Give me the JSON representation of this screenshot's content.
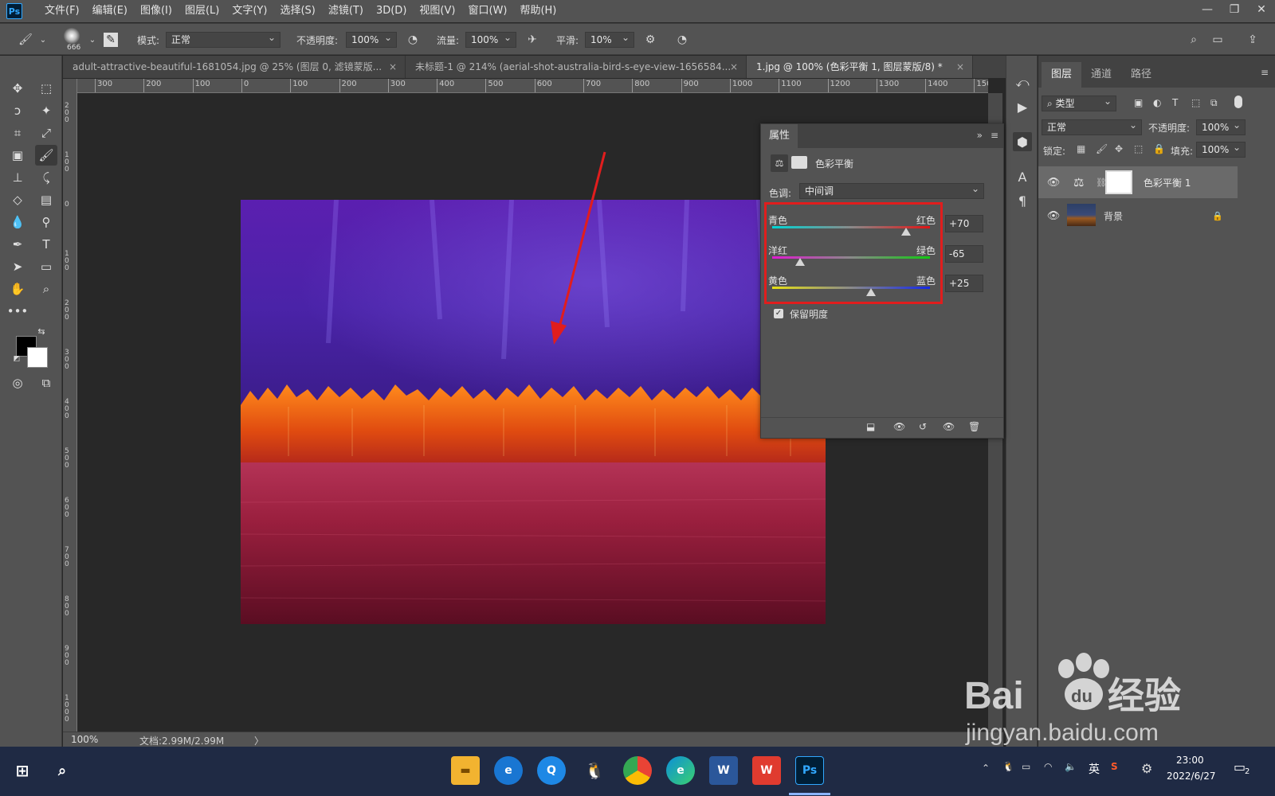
{
  "app": {
    "logo": "Ps"
  },
  "menu": [
    "文件(F)",
    "编辑(E)",
    "图像(I)",
    "图层(L)",
    "文字(Y)",
    "选择(S)",
    "滤镜(T)",
    "3D(D)",
    "视图(V)",
    "窗口(W)",
    "帮助(H)"
  ],
  "options": {
    "brush_size": "666",
    "mode_label": "模式:",
    "mode_value": "正常",
    "opacity_label": "不透明度:",
    "opacity_value": "100%",
    "flow_label": "流量:",
    "flow_value": "100%",
    "smooth_label": "平滑:",
    "smooth_value": "10%"
  },
  "tabs": [
    {
      "title": "adult-attractive-beautiful-1681054.jpg  @  25% (图层 0, 滤镜蒙版...",
      "close": "×"
    },
    {
      "title": "未标题-1 @ 214% (aerial-shot-australia-bird-s-eye-view-1656584...",
      "close": "×"
    },
    {
      "title": "1.jpg @ 100% (色彩平衡 1, 图层蒙版/8) *",
      "close": "×"
    }
  ],
  "ruler_top": [
    "300",
    "200",
    "100",
    "0",
    "100",
    "200",
    "300",
    "400",
    "500",
    "600",
    "700",
    "800",
    "900",
    "1000",
    "1100",
    "1200",
    "1300",
    "1400",
    "150"
  ],
  "ruler_left": [
    "200",
    "100",
    "0",
    "100",
    "200",
    "300",
    "400",
    "500",
    "600",
    "700",
    "800",
    "900",
    "1000"
  ],
  "status": {
    "zoom": "100%",
    "doc": "文档:2.99M/2.99M",
    "arrow": "〉"
  },
  "properties": {
    "tab": "属性",
    "adjustment_name": "色彩平衡",
    "tone_label": "色调:",
    "tone_value": "中间调",
    "preserve_label": "保留明度",
    "sliders": [
      {
        "left": "青色",
        "right": "红色",
        "value": "+70",
        "level": 70
      },
      {
        "left": "洋红",
        "right": "绿色",
        "value": "-65",
        "level": -65
      },
      {
        "left": "黄色",
        "right": "蓝色",
        "value": "+25",
        "level": 25
      }
    ]
  },
  "layers_panel": {
    "tabs": [
      "图层",
      "通道",
      "路径"
    ],
    "filter_label": "类型",
    "blend_mode": "正常",
    "opacity_label": "不透明度:",
    "opacity_value": "100%",
    "lock_label": "锁定:",
    "fill_label": "填充:",
    "fill_value": "100%",
    "layers": [
      {
        "name": "色彩平衡 1"
      },
      {
        "name": "背景"
      }
    ]
  },
  "taskbar": {
    "time": "23:00",
    "date": "2022/6/27",
    "ime": "英",
    "notif_count": "2"
  },
  "watermark": {
    "brand": "Bai",
    "brand2": "du",
    "cn": "经验",
    "url": "jingyan.baidu.com"
  },
  "colors": {
    "highlight": "#e11d1d",
    "arrow": "#e11d1d"
  }
}
